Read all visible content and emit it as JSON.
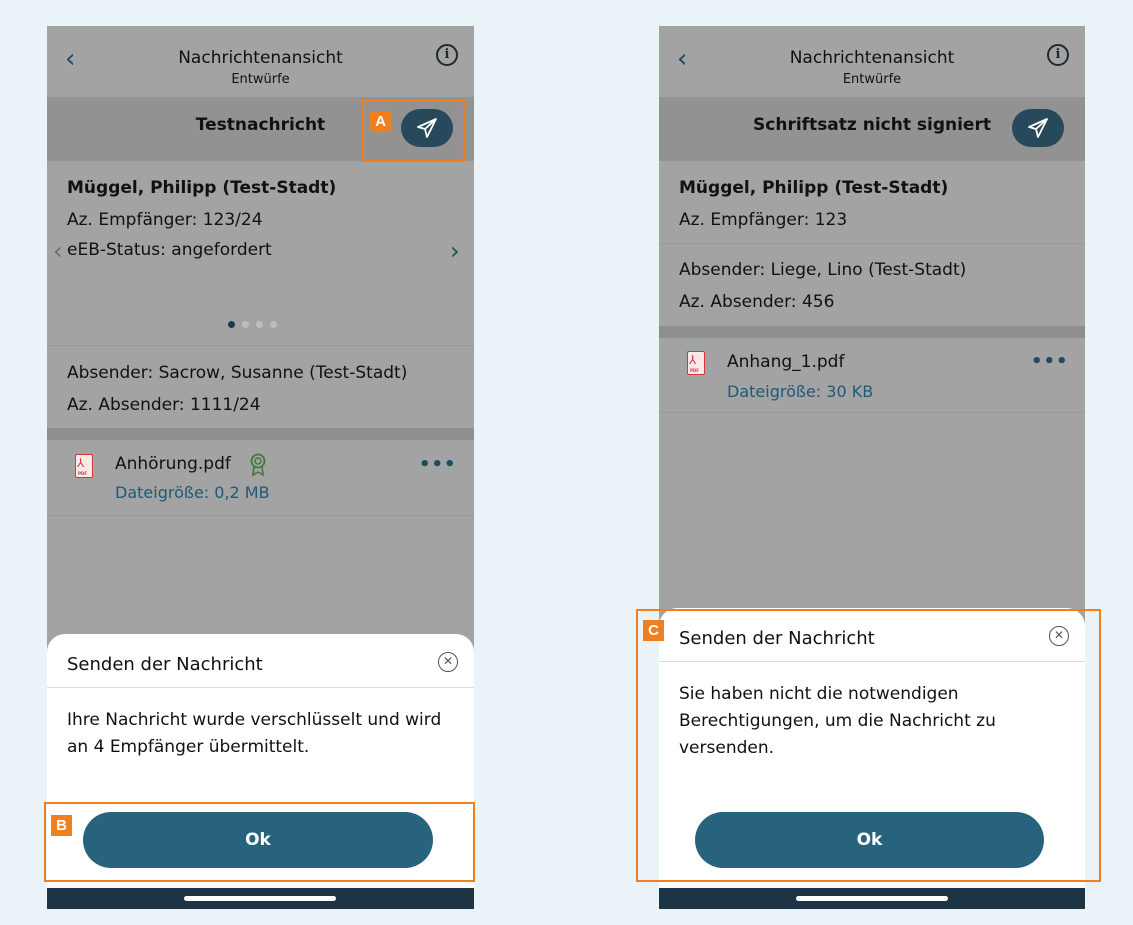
{
  "left": {
    "header": {
      "title": "Nachrichtenansicht",
      "subtitle": "Entwürfe"
    },
    "subject": "Testnachricht",
    "recipient": {
      "name": "Müggel, Philipp (Test-Stadt)",
      "az": "Az. Empfänger: 123/24",
      "eeb": "eEB-Status: angefordert"
    },
    "carousel_pages": 4,
    "sender": {
      "name": "Absender: Sacrow, Susanne (Test-Stadt)",
      "az": "Az. Absender: 1111/24"
    },
    "attachment": {
      "name": "Anhörung.pdf",
      "size": "Dateigröße: 0,2 MB"
    },
    "dialog": {
      "title": "Senden der Nachricht",
      "body": "Ihre Nachricht wurde verschlüsselt und wird an 4 Empfänger übermittelt.",
      "ok": "Ok"
    }
  },
  "right": {
    "header": {
      "title": "Nachrichtenansicht",
      "subtitle": "Entwürfe"
    },
    "subject": "Schriftsatz nicht signiert",
    "recipient": {
      "name": "Müggel, Philipp (Test-Stadt)",
      "az": "Az. Empfänger: 123"
    },
    "sender": {
      "name": "Absender: Liege, Lino (Test-Stadt)",
      "az": "Az. Absender: 456"
    },
    "attachment": {
      "name": "Anhang_1.pdf",
      "size": "Dateigröße: 30 KB"
    },
    "dialog": {
      "title": "Senden der Nachricht",
      "body": "Sie haben nicht die notwendigen Berechtigungen, um die Nachricht zu versenden.",
      "ok": "Ok"
    }
  },
  "annotations": {
    "a": "A",
    "b": "B",
    "c": "C"
  },
  "icons": {
    "back": "chevron-left-icon",
    "info": "info-icon",
    "send": "paper-plane-icon",
    "pdf": "pdf-file-icon",
    "award": "award-icon",
    "more": "more-horizontal-icon",
    "close": "close-circle-icon"
  },
  "colors": {
    "accent": "#27637d",
    "annotation": "#f07f1f",
    "link": "#1c5a77"
  }
}
